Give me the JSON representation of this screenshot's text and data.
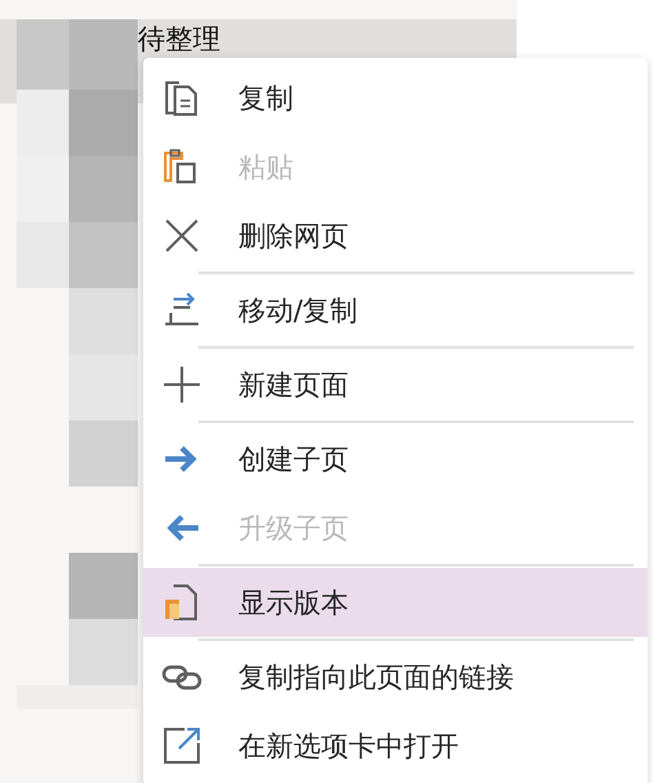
{
  "page_list": {
    "selected_page": {
      "title": "待整理"
    }
  },
  "context_menu": {
    "items": [
      {
        "label": "复制",
        "disabled": false,
        "selected": false,
        "separator_after": false
      },
      {
        "label": "粘贴",
        "disabled": true,
        "selected": false,
        "separator_after": false
      },
      {
        "label": "删除网页",
        "disabled": false,
        "selected": false,
        "separator_after": true
      },
      {
        "label": "移动/复制",
        "disabled": false,
        "selected": false,
        "separator_after": true
      },
      {
        "label": "新建页面",
        "disabled": false,
        "selected": false,
        "separator_after": true
      },
      {
        "label": "创建子页",
        "disabled": false,
        "selected": false,
        "separator_after": false
      },
      {
        "label": "升级子页",
        "disabled": true,
        "selected": false,
        "separator_after": true
      },
      {
        "label": "显示版本",
        "disabled": false,
        "selected": true,
        "separator_after": true
      },
      {
        "label": "复制指向此页面的链接",
        "disabled": false,
        "selected": false,
        "separator_after": false
      },
      {
        "label": "在新选项卡中打开",
        "disabled": false,
        "selected": false,
        "separator_after": false
      }
    ]
  }
}
